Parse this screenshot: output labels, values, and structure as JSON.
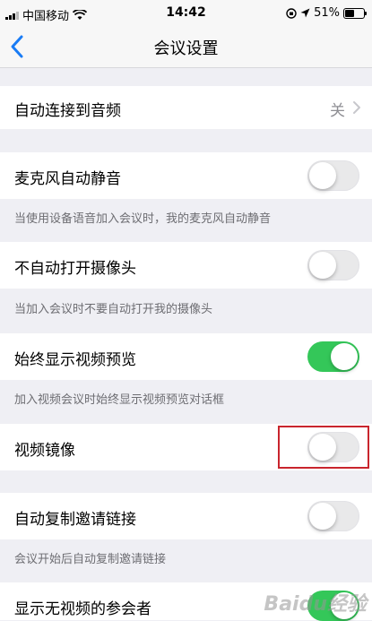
{
  "status_bar": {
    "carrier": "中国移动",
    "time": "14:42",
    "battery": "51%"
  },
  "nav": {
    "title": "会议设置"
  },
  "settings": {
    "auto_audio": {
      "label": "自动连接到音频",
      "value": "关"
    },
    "mute_mic": {
      "label": "麦克风自动静音",
      "on": false,
      "desc": "当使用设备语音加入会议时，我的麦克风自动静音"
    },
    "no_camera": {
      "label": "不自动打开摄像头",
      "on": false,
      "desc": "当加入会议时不要自动打开我的摄像头"
    },
    "video_preview": {
      "label": "始终显示视频预览",
      "on": true,
      "desc": "加入视频会议时始终显示视频预览对话框"
    },
    "mirror": {
      "label": "视频镜像",
      "on": false
    },
    "copy_invite": {
      "label": "自动复制邀请链接",
      "on": false,
      "desc": "会议开始后自动复制邀请链接"
    },
    "show_no_video": {
      "label": "显示无视频的参会者",
      "on": true
    }
  },
  "colors": {
    "toggle_on": "#34c759",
    "accent": "#1a7cf5",
    "highlight_box": "#c9252d"
  },
  "watermark": "Baidu经验"
}
